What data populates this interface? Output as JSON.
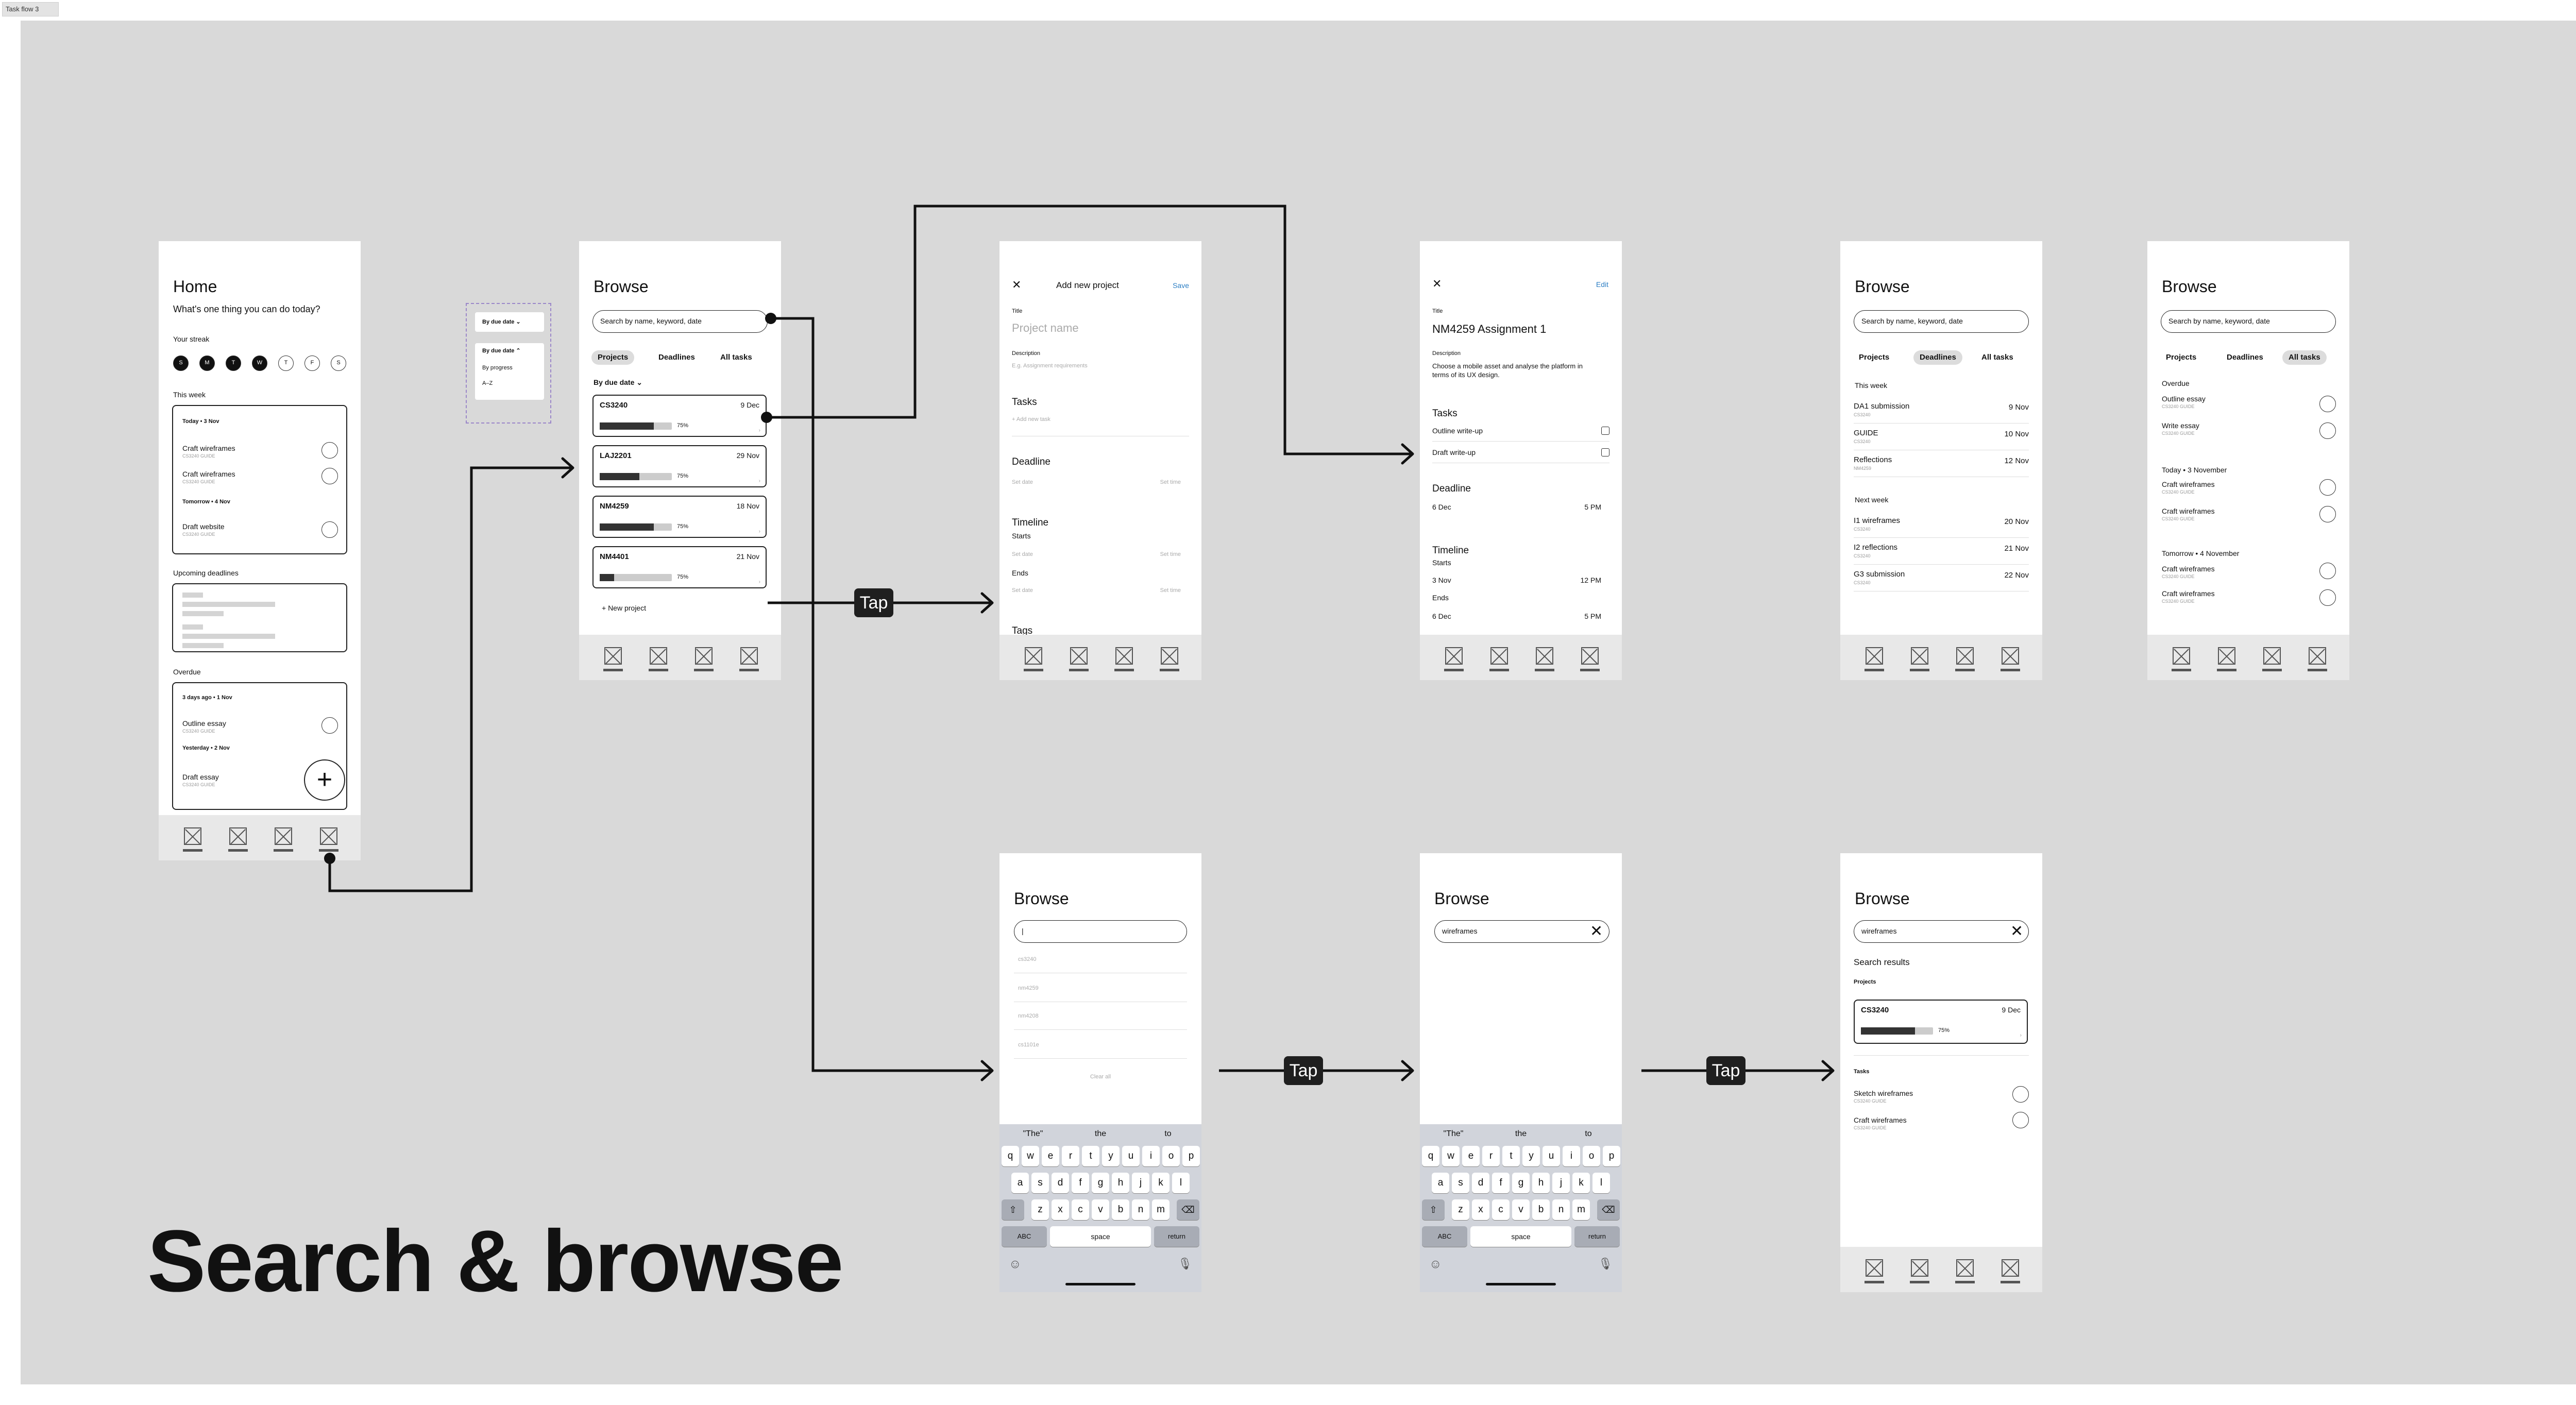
{
  "frame_label": "Task flow 3",
  "section_title": "Search & browse",
  "tap_label": "Tap",
  "home": {
    "title": "Home",
    "subtitle": "What's one thing you can do today?",
    "streak_label": "Your streak",
    "days": [
      "S",
      "M",
      "T",
      "W",
      "T",
      "F",
      "S"
    ],
    "this_week": "This week",
    "today_hdr": "Today • 3 Nov",
    "tomorrow_hdr": "Tomorrow • 4 Nov",
    "tasks": [
      {
        "name": "Craft wireframes",
        "course": "CS3240 GUIDE"
      },
      {
        "name": "Craft wireframes",
        "course": "CS3240 GUIDE"
      },
      {
        "name": "Draft website",
        "course": "CS3240 GUIDE"
      }
    ],
    "upcoming": "Upcoming deadlines",
    "overdue": "Overdue",
    "od_hdr1": "3 days ago • 1 Nov",
    "od_hdr2": "Yesterday • 2 Nov",
    "od_tasks": [
      {
        "name": "Outline essay",
        "course": "CS3240 GUIDE"
      },
      {
        "name": "Draft essay",
        "course": "CS3240 GUIDE"
      }
    ],
    "fab": "+"
  },
  "sort_popup": {
    "top": "By due date ⌄",
    "sel": "By due date ⌃",
    "opt1": "By progress",
    "opt2": "A–Z"
  },
  "browse": {
    "title": "Browse",
    "placeholder": "Search by name, keyword, date",
    "tabs": [
      "Projects",
      "Deadlines",
      "All tasks"
    ],
    "sort": "By due date ⌄",
    "projects": [
      {
        "code": "CS3240",
        "date": "9 Dec",
        "pct": "75%",
        "progress": 0.75
      },
      {
        "code": "LAJ2201",
        "date": "29 Nov",
        "pct": "75%",
        "progress": 0.55
      },
      {
        "code": "NM4259",
        "date": "18 Nov",
        "pct": "75%",
        "progress": 0.75
      },
      {
        "code": "NM4401",
        "date": "21 Nov",
        "pct": "75%",
        "progress": 0.2
      }
    ],
    "new_project": "+ New project"
  },
  "add_project": {
    "close": "✕",
    "title": "Add new project",
    "save": "Save",
    "title_label": "Title",
    "title_ph": "Project name",
    "desc_label": "Description",
    "desc_ph": "E.g. Assignment requirements",
    "tasks_label": "Tasks",
    "tasks_ph": "+ Add new task",
    "deadline_label": "Deadline",
    "date_ph": "Set date",
    "time_ph": "Set time",
    "timeline_label": "Timeline",
    "starts": "Starts",
    "ends": "Ends",
    "tags": "Tags"
  },
  "project_detail": {
    "close": "✕",
    "edit": "Edit",
    "title_label": "Title",
    "title": "NM4259 Assignment 1",
    "desc_label": "Description",
    "desc": "Choose a mobile asset and analyse the platform in terms of its UX design.",
    "tasks_label": "Tasks",
    "tasks": [
      "Outline write-up",
      "Draft write-up"
    ],
    "deadline_label": "Deadline",
    "deadline_date": "6 Dec",
    "deadline_time": "5 PM",
    "timeline_label": "Timeline",
    "starts": "Starts",
    "start_date": "3 Nov",
    "start_time": "12 PM",
    "ends": "Ends",
    "end_date": "6 Dec",
    "end_time": "5 PM"
  },
  "deadlines": {
    "this_week": "This week",
    "next_week": "Next week",
    "items1": [
      {
        "n": "DA1 submission",
        "s": "CS3240",
        "v": "9 Nov"
      },
      {
        "n": "GUIDE",
        "s": "CS3240",
        "v": "10 Nov"
      },
      {
        "n": "Reflections",
        "s": "NM4259",
        "v": "12 Nov"
      }
    ],
    "items2": [
      {
        "n": "I1 wireframes",
        "s": "CS3240",
        "v": "20 Nov"
      },
      {
        "n": "I2 reflections",
        "s": "CS3240",
        "v": "21 Nov"
      },
      {
        "n": "G3 submission",
        "s": "CS3240",
        "v": "22 Nov"
      }
    ]
  },
  "all_tasks": {
    "overdue": "Overdue",
    "today": "Today • 3 November",
    "tomorrow": "Tomorrow • 4 November",
    "course": "CS3240 GUIDE",
    "overdue_items": [
      "Outline essay",
      "Write essay"
    ],
    "today_items": [
      "Craft wireframes",
      "Craft wireframes"
    ],
    "tomorrow_items": [
      "Craft wireframes",
      "Craft wireframes"
    ]
  },
  "search_recent": {
    "input": "|",
    "recents": [
      "cs3240",
      "nm4259",
      "nm4208",
      "cs1101e"
    ],
    "clear_all": "Clear all"
  },
  "keyboard": {
    "suggestions": [
      "\"The\"",
      "the",
      "to"
    ],
    "row1": [
      "q",
      "w",
      "e",
      "r",
      "t",
      "y",
      "u",
      "i",
      "o",
      "p"
    ],
    "row2": [
      "a",
      "s",
      "d",
      "f",
      "g",
      "h",
      "j",
      "k",
      "l"
    ],
    "row3": [
      "z",
      "x",
      "c",
      "v",
      "b",
      "n",
      "m"
    ],
    "shift": "⇧",
    "backspace": "⌫",
    "abc": "ABC",
    "space": "space",
    "return": "return",
    "emoji": "☺",
    "mic": "🎙"
  },
  "search_typed": {
    "value": "wireframes",
    "clear": "✕"
  },
  "search_results": {
    "value": "wireframes",
    "clear": "✕",
    "heading": "Search results",
    "projects_label": "Projects",
    "tasks_label": "Tasks",
    "project": {
      "code": "CS3240",
      "date": "9 Dec",
      "pct": "75%",
      "progress": 0.75
    },
    "tasks": [
      {
        "name": "Sketch wireframes",
        "course": "CS3240 GUIDE"
      },
      {
        "name": "Craft wireframes",
        "course": "CS3240 GUIDE"
      }
    ]
  }
}
